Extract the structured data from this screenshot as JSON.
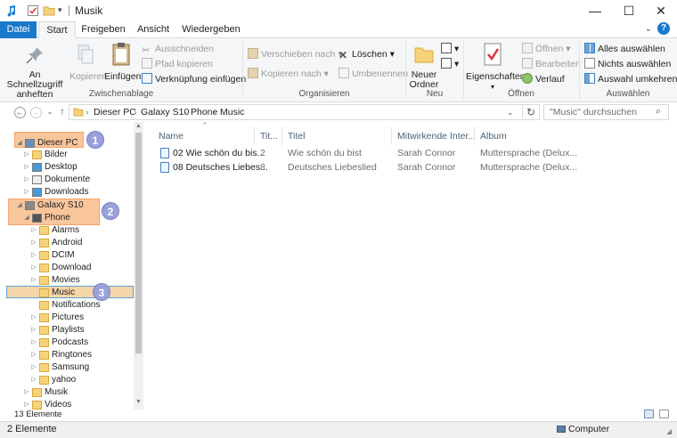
{
  "window": {
    "title": "Musik",
    "controls": {
      "minimize": "—",
      "maximize": "☐",
      "close": "✕"
    }
  },
  "ribbon_tabs": [
    "Datei",
    "Start",
    "Freigeben",
    "Ansicht",
    "Wiedergeben"
  ],
  "ribbon": {
    "zwischenablage": {
      "label": "Zwischenablage",
      "pin": "An Schnellzugriff anheften",
      "copy": "Kopieren",
      "paste": "Einfügen",
      "cut": "Ausschneiden",
      "copy_path": "Pfad kopieren",
      "paste_shortcut": "Verknüpfung einfügen"
    },
    "organisieren": {
      "label": "Organisieren",
      "move_to": "Verschieben nach",
      "copy_to": "Kopieren nach",
      "delete": "Löschen",
      "rename": "Umbenennen"
    },
    "neu": {
      "label": "Neu",
      "new_folder": "Neuer Ordner"
    },
    "oeffnen": {
      "label": "Öffnen",
      "properties": "Eigenschaften",
      "open": "Öffnen",
      "edit": "Bearbeiten",
      "history": "Verlauf"
    },
    "auswaehlen": {
      "label": "Auswählen",
      "select_all": "Alles auswählen",
      "select_none": "Nichts auswählen",
      "invert": "Auswahl umkehren"
    }
  },
  "address": {
    "crumbs": [
      "Dieser PC",
      "Galaxy S10",
      "Phone",
      "Music"
    ],
    "search_placeholder": "\"Music\" durchsuchen"
  },
  "nav_tree": [
    "Dieser PC",
    "Bilder",
    "Desktop",
    "Dokumente",
    "Downloads",
    "Galaxy S10",
    "Phone",
    "Alarms",
    "Android",
    "DCIM",
    "Download",
    "Movies",
    "Music",
    "Notifications",
    "Pictures",
    "Playlists",
    "Podcasts",
    "Ringtones",
    "Samsung",
    "yahoo",
    "Musik",
    "Videos"
  ],
  "badges": [
    "1",
    "2",
    "3"
  ],
  "columns": [
    "Name",
    "Tit...",
    "Titel",
    "Mitwirkende Inter...",
    "Album"
  ],
  "files": [
    {
      "name": "02 Wie schön du bis...",
      "track": "2",
      "title": "Wie schön du bist",
      "artist": "Sarah Connor",
      "album": "Muttersprache (Delux..."
    },
    {
      "name": "08 Deutsches Liebes...",
      "track": "8",
      "title": "Deutsches Liebeslied",
      "artist": "Sarah Connor",
      "album": "Muttersprache (Delux..."
    }
  ],
  "status": {
    "nav_count": "13 Elemente",
    "count": "2 Elemente",
    "location": "Computer"
  },
  "colors": {
    "file_tab": "#1979ca",
    "highlight": "#f9c69c",
    "badge": "#9aa0da",
    "folder": "#e8b84a"
  }
}
